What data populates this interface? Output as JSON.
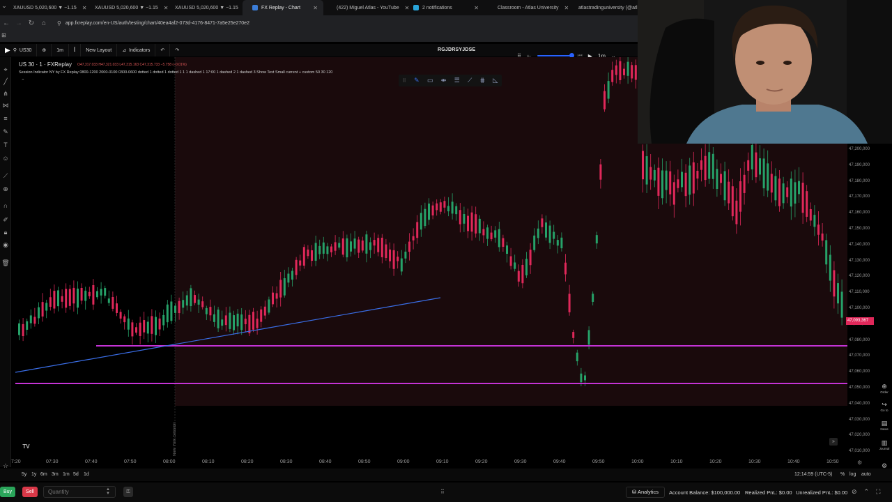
{
  "browser": {
    "tabs": [
      {
        "label": "XAUUSD 5,020,600 ▼ −1.15",
        "color": "#f3b33d"
      },
      {
        "label": "XAUUSD 5,020,600 ▼ −1.15",
        "color": "#f3b33d"
      },
      {
        "label": "XAUUSD 5,020,600 ▼ −1.15",
        "color": "#f3b33d"
      },
      {
        "label": "FX Replay - Chart",
        "color": "#3b7dd8"
      },
      {
        "label": "(422) Miguel Atlas - YouTube",
        "color": "#e53935"
      },
      {
        "label": "2 notifications",
        "color": "#29a4d9"
      },
      {
        "label": "Classroom - Atlas University",
        "color": "#888888"
      },
      {
        "label": "atlastradinguniversity (@atl",
        "color": "#999999"
      }
    ],
    "url": "app.fxreplay.com/en-US/auth/testing/chart/40ea4af2-073d-4176-8471-7a5e25e270e2"
  },
  "toolbar": {
    "symbol": "US30",
    "interval": "1m",
    "new_layout": "New Layout",
    "indicators": "Indicators",
    "session_id": "RGJDRSYJDSE"
  },
  "replay": {
    "interval": "1m",
    "progress": 0.9
  },
  "legend": {
    "title": "US 30 · 1 · FXReplay",
    "ohlc": "O47,317.033 H47,321.033 L47,315.163 C47,315.733 −5.758 (−0.01%)",
    "indicator": "Session Indicator NY by FX Replay 0800-1200 2000-0100 0300-0600 dotted 1 dotted 1 dotted 1 1 1 dashed 1 17:00 1 dashed 2 1 dashed 3 Show Text Small current + custom 50 30 120"
  },
  "price_axis": {
    "ticks": [
      "47,200,000",
      "47,190,000",
      "47,180,000",
      "47,170,000",
      "47,160,000",
      "47,150,000",
      "47,140,000",
      "47,130,000",
      "47,120,000",
      "47,110,000",
      "47,100,000",
      "47,090,000",
      "47,080,000",
      "47,070,000",
      "47,060,000",
      "47,050,000",
      "47,040,000",
      "47,030,000",
      "47,020,000",
      "47,010,000"
    ],
    "current_price": "47,093,367"
  },
  "time_axis": {
    "labels": [
      "7:20",
      "07:30",
      "07:40",
      "07:50",
      "08:00",
      "08:10",
      "08:20",
      "08:30",
      "08:40",
      "08:50",
      "09:00",
      "09:10",
      "09:20",
      "09:30",
      "09:40",
      "09:50",
      "10:00",
      "10:10",
      "10:20",
      "10:30",
      "10:40",
      "10:50"
    ]
  },
  "chart": {
    "session_label": "New York Session",
    "up_color": "#26a269",
    "down_color": "#e0285a",
    "level_color": "#c533d6",
    "trendline_color": "#3a6ee8"
  },
  "range_bar": {
    "ranges": [
      "5y",
      "1y",
      "6m",
      "3m",
      "1m",
      "5d",
      "1d"
    ],
    "clock": "12:14:59 (UTC-5)",
    "percent": "%",
    "log": "log",
    "auto": "auto"
  },
  "trade_bar": {
    "buy": "Buy",
    "sell": "Sell",
    "quantity_placeholder": "Quantity",
    "analytics": "Analytics",
    "account_balance": "Account Balance: $100,000.00",
    "realized_pnl": "Realized PnL: $0.00",
    "unrealized_pnl": "Unrealized PnL: $0.00"
  },
  "right_panel": {
    "items": [
      "Order",
      "Go to",
      "News",
      "Journal"
    ]
  }
}
